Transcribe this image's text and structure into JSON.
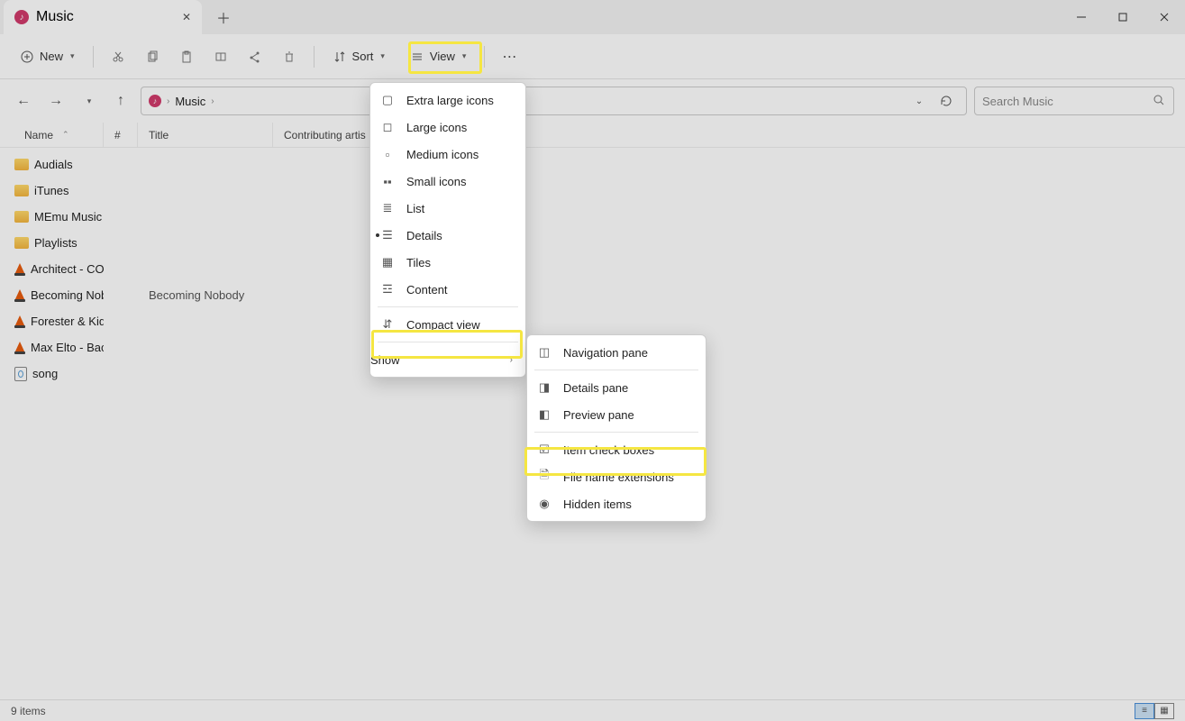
{
  "tab": {
    "title": "Music"
  },
  "toolbar": {
    "new": "New",
    "sort": "Sort",
    "view": "View"
  },
  "breadcrumb": {
    "root": "Music"
  },
  "search": {
    "placeholder": "Search Music"
  },
  "columns": {
    "name": "Name",
    "num": "#",
    "title": "Title",
    "artist": "Contributing artis"
  },
  "files": [
    {
      "type": "folder",
      "name": "Audials"
    },
    {
      "type": "folder",
      "name": "iTunes"
    },
    {
      "type": "folder",
      "name": "MEmu Music"
    },
    {
      "type": "folder",
      "name": "Playlists"
    },
    {
      "type": "media",
      "name": "Architect - COL..."
    },
    {
      "type": "media",
      "name": "Becoming Nob...",
      "title": "Becoming Nobody"
    },
    {
      "type": "media",
      "name": "Forester & Kidn..."
    },
    {
      "type": "media",
      "name": "Max Elto - Back..."
    },
    {
      "type": "file",
      "name": "song"
    }
  ],
  "status": {
    "count": "9 items"
  },
  "view_menu": {
    "extra_large": "Extra large icons",
    "large": "Large icons",
    "medium": "Medium icons",
    "small": "Small icons",
    "list": "List",
    "details": "Details",
    "tiles": "Tiles",
    "content": "Content",
    "compact": "Compact view",
    "show": "Show"
  },
  "show_menu": {
    "nav": "Navigation pane",
    "details": "Details pane",
    "preview": "Preview pane",
    "checkboxes": "Item check boxes",
    "extensions": "File name extensions",
    "hidden": "Hidden items"
  }
}
